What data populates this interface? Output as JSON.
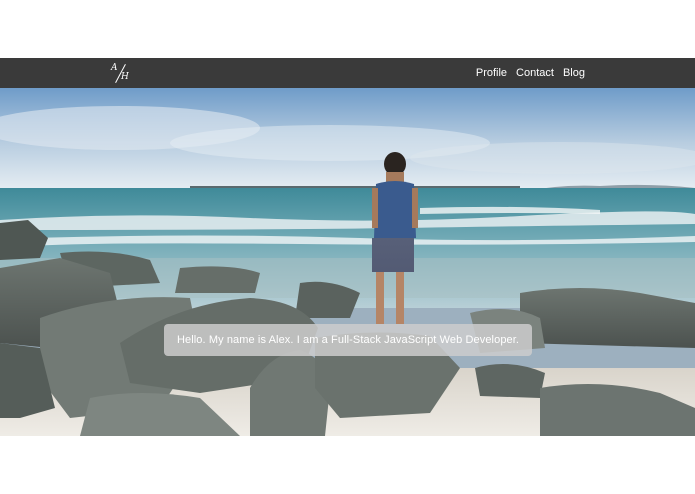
{
  "nav": {
    "logo": {
      "top": "A",
      "bottom": "H"
    },
    "links": [
      {
        "label": "Profile"
      },
      {
        "label": "Contact"
      },
      {
        "label": "Blog"
      }
    ]
  },
  "hero": {
    "tagline": "Hello. My name is Alex. I am a Full-Stack JavaScript Web Developer."
  },
  "colors": {
    "navbar": "#3a3a3a",
    "text": "#ffffff",
    "banner": "#cdcdcd"
  }
}
